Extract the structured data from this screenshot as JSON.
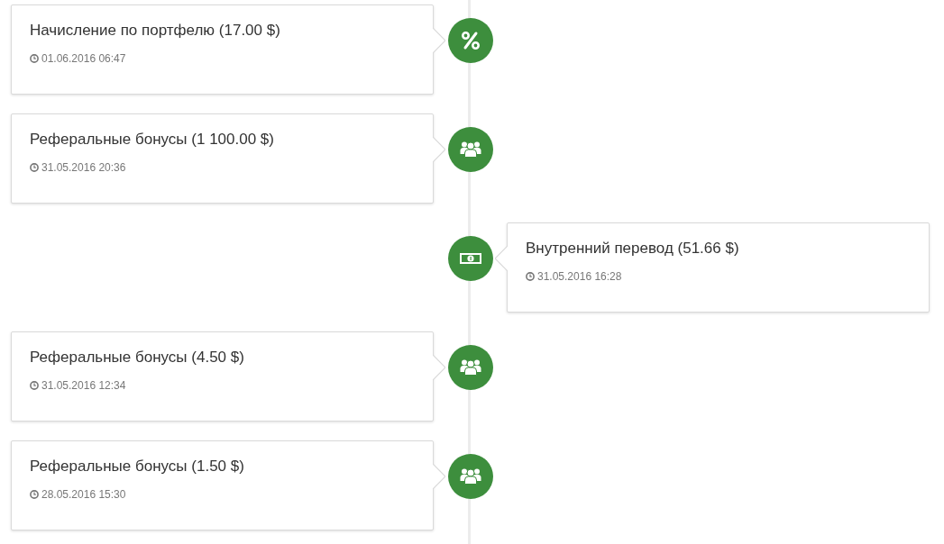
{
  "timeline": [
    {
      "kind": "interest",
      "on_right": false,
      "title": "Начисление по портфелю (17.00 $)",
      "time": "01.06.2016 06:47"
    },
    {
      "kind": "referral",
      "on_right": false,
      "title": "Реферальные бонусы (1 100.00 $)",
      "time": "31.05.2016 20:36"
    },
    {
      "kind": "transfer",
      "on_right": true,
      "title": "Внутренний перевод (51.66 $)",
      "time": "31.05.2016 16:28"
    },
    {
      "kind": "referral",
      "on_right": false,
      "title": "Реферальные бонусы (4.50 $)",
      "time": "31.05.2016 12:34"
    },
    {
      "kind": "referral",
      "on_right": false,
      "title": "Реферальные бонусы (1.50 $)",
      "time": "28.05.2016 15:30"
    }
  ]
}
